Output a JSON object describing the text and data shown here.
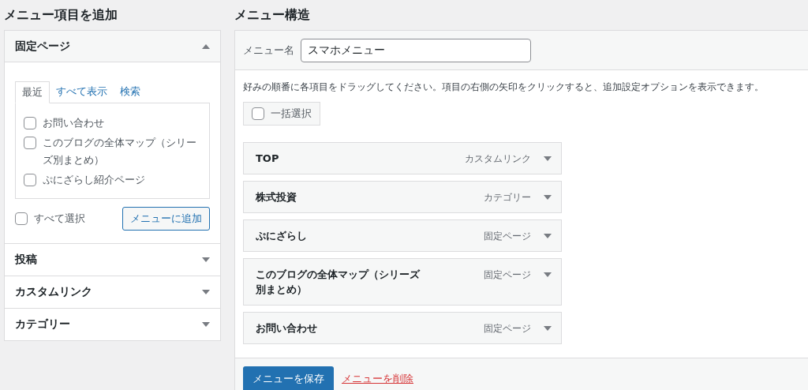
{
  "add_items": {
    "heading": "メニュー項目を追加",
    "sections": [
      {
        "title": "固定ページ",
        "expanded": true,
        "tabs": [
          {
            "label": "最近",
            "selected": true
          },
          {
            "label": "すべて表示",
            "selected": false
          },
          {
            "label": "検索",
            "selected": false
          }
        ],
        "items": [
          {
            "label": "お問い合わせ",
            "checked": false
          },
          {
            "label": "このブログの全体マップ（シリーズ別まとめ）",
            "checked": false
          },
          {
            "label": "ぷにざらし紹介ページ",
            "checked": false
          }
        ],
        "select_all": {
          "label": "すべて選択",
          "checked": false
        },
        "add_button": "メニューに追加"
      },
      {
        "title": "投稿",
        "expanded": false
      },
      {
        "title": "カスタムリンク",
        "expanded": false
      },
      {
        "title": "カテゴリー",
        "expanded": false
      }
    ]
  },
  "structure": {
    "heading": "メニュー構造",
    "name_label": "メニュー名",
    "name_value": "スマホメニュー",
    "instructions": "好みの順番に各項目をドラッグしてください。項目の右側の矢印をクリックすると、追加設定オプションを表示できます。",
    "bulk_select": {
      "label": "一括選択",
      "checked": false
    },
    "items": [
      {
        "title": "TOP",
        "type": "カスタムリンク"
      },
      {
        "title": "株式投資",
        "type": "カテゴリー"
      },
      {
        "title": "ぷにざらし",
        "type": "固定ページ"
      },
      {
        "title": "このブログの全体マップ（シリーズ別まとめ）",
        "type": "固定ページ"
      },
      {
        "title": "お問い合わせ",
        "type": "固定ページ"
      }
    ],
    "save_button": "メニューを保存",
    "delete_link": "メニューを削除"
  }
}
